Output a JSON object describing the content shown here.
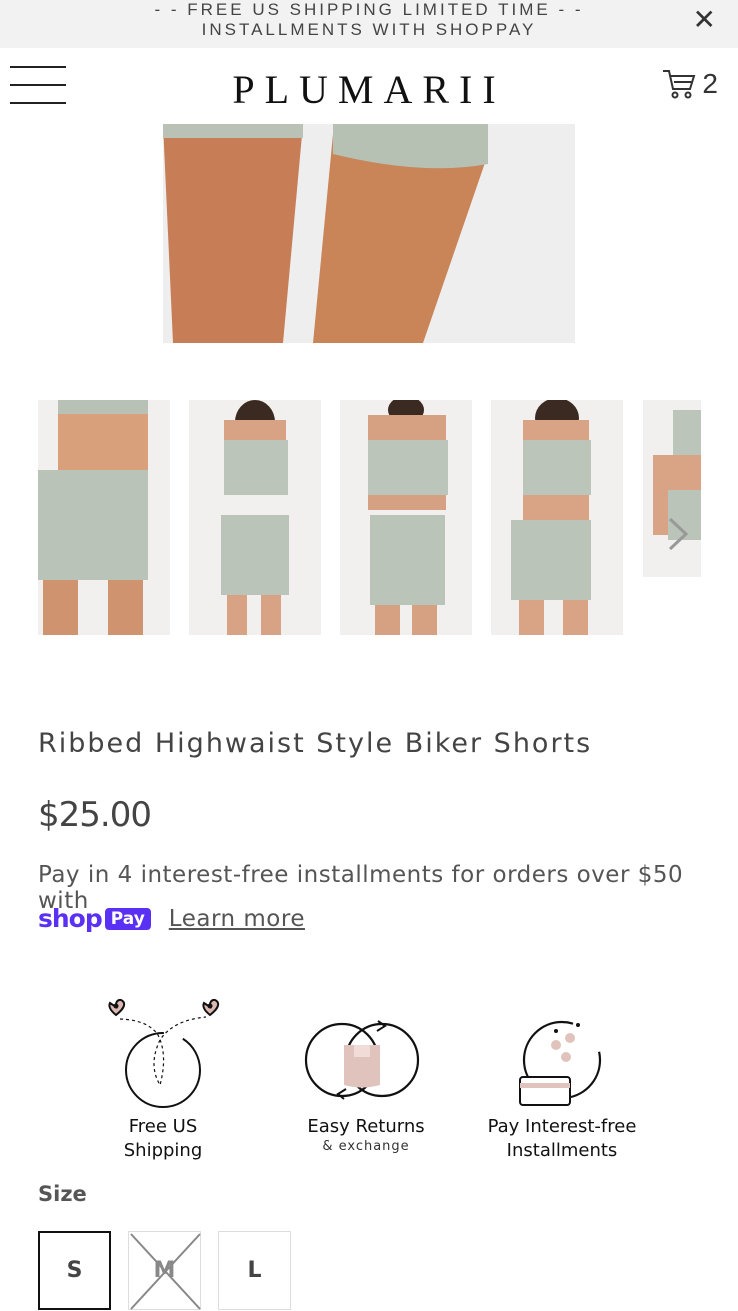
{
  "announcement": {
    "line1": "- - FREE US SHIPPING LIMITED TIME - -",
    "line2": "INSTALLMENTS WITH SHOPPAY",
    "close_icon": "close-icon"
  },
  "header": {
    "logo": "PLUMARII",
    "menu_icon": "hamburger-menu-icon",
    "cart_icon": "cart-icon",
    "cart_count": "2"
  },
  "product": {
    "title": "Ribbed Highwaist Style Biker Shorts",
    "price": "$25.00",
    "installments_text": "Pay in 4 interest-free installments for orders over $50 with",
    "shop_word": "shop",
    "pay_word": "Pay",
    "learn_more": "Learn more",
    "brand_color": "#5a31f4"
  },
  "features": [
    {
      "label_line1": "Free US",
      "label_line2": "Shipping",
      "icon": "shipping-route-icon"
    },
    {
      "label_line1": "Easy Returns",
      "label_line2": "& exchange",
      "icon": "returns-icon"
    },
    {
      "label_line1": "Pay Interest-free",
      "label_line2": "Installments",
      "icon": "card-coins-icon"
    }
  ],
  "size": {
    "label": "Size",
    "options": [
      {
        "label": "S",
        "state": "selected"
      },
      {
        "label": "M",
        "state": "unavailable"
      },
      {
        "label": "L",
        "state": "available"
      }
    ]
  }
}
